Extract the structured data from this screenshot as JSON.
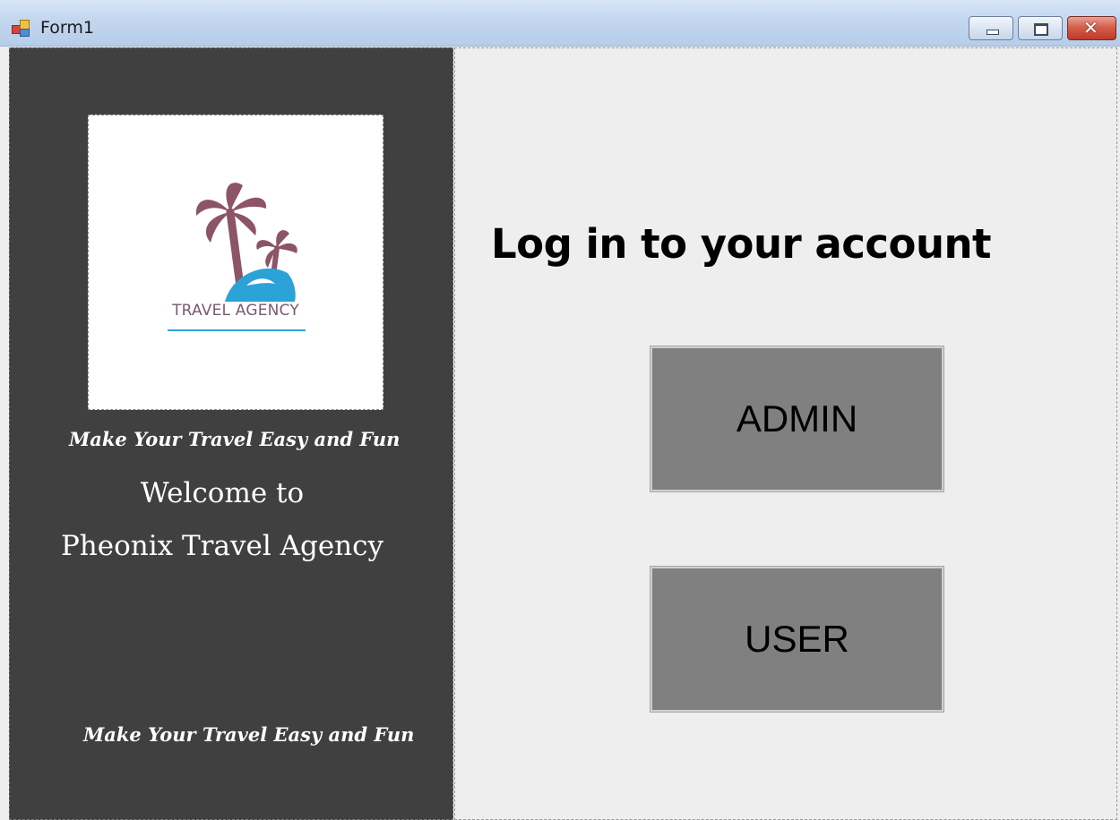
{
  "window": {
    "title": "Form1",
    "close_glyph": "✕"
  },
  "left_panel": {
    "logo": {
      "caption": "TRAVEL AGENCY",
      "palm_color": "#8c5466",
      "wave_color": "#2ba3d6"
    },
    "tagline_top": "Make Your Travel Easy and Fun",
    "welcome_line1": "Welcome to",
    "welcome_line2": "Pheonix Travel Agency",
    "tagline_bottom": "Make Your Travel Easy and Fun",
    "background": "#404040"
  },
  "right_panel": {
    "heading": "Log in to your account",
    "admin_button": "ADMIN",
    "user_button": "USER",
    "button_color": "#808080"
  }
}
